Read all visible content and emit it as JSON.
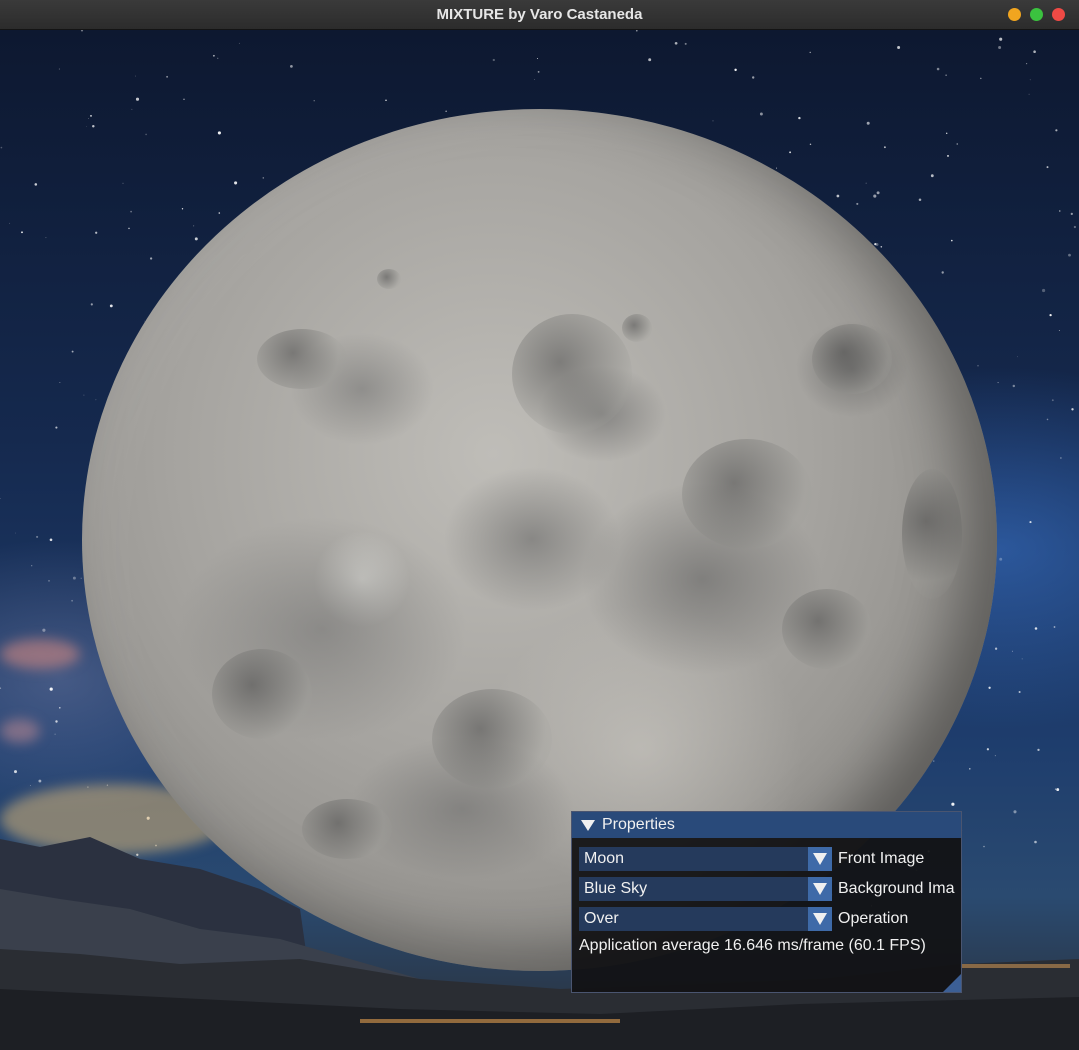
{
  "window": {
    "title": "MIXTURE by Varo Castaneda"
  },
  "colors": {
    "panel_header": "#294a7a",
    "combo_bg": "#253a5c",
    "combo_button": "#3e6aa8",
    "close": "#ef4a45",
    "minimize": "#f1a51f",
    "maximize": "#3bc23f"
  },
  "canvas": {
    "front_subject": "moon",
    "background_subject": "night sky with mountains"
  },
  "properties": {
    "header": "Properties",
    "rows": [
      {
        "value": "Moon",
        "label": "Front Image",
        "icon": "chevron-down-icon"
      },
      {
        "value": "Blue Sky",
        "label": "Background Ima",
        "icon": "chevron-down-icon"
      },
      {
        "value": "Over",
        "label": "Operation",
        "icon": "chevron-down-icon"
      }
    ],
    "stats": "Application average 16.646 ms/frame (60.1 FPS)"
  }
}
